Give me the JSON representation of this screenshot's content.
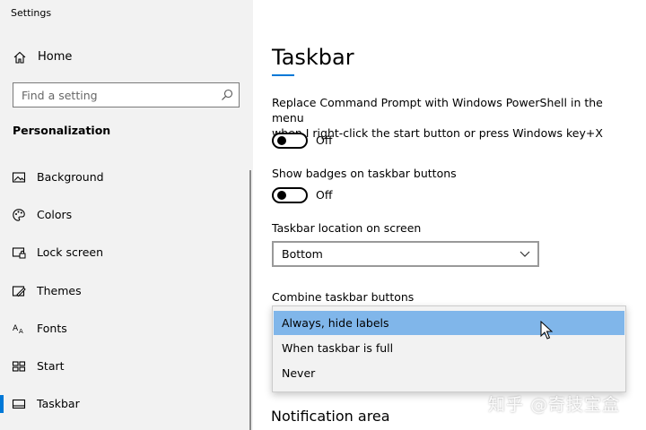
{
  "window": {
    "title": "Settings"
  },
  "sidebar": {
    "home_label": "Home",
    "search_placeholder": "Find a setting",
    "section_title": "Personalization",
    "items": [
      {
        "label": "Background",
        "icon": "image-icon"
      },
      {
        "label": "Colors",
        "icon": "palette-icon"
      },
      {
        "label": "Lock screen",
        "icon": "lock-screen-icon"
      },
      {
        "label": "Themes",
        "icon": "themes-icon"
      },
      {
        "label": "Fonts",
        "icon": "fonts-icon"
      },
      {
        "label": "Start",
        "icon": "start-icon"
      },
      {
        "label": "Taskbar",
        "icon": "taskbar-icon",
        "active": true
      }
    ]
  },
  "main": {
    "title": "Taskbar",
    "settings": {
      "powershell": {
        "line1": "Replace Command Prompt with Windows PowerShell in the menu",
        "line2": "when I right-click the start button or press Windows key+X",
        "state": "Off"
      },
      "badges": {
        "label": "Show badges on taskbar buttons",
        "state": "Off"
      },
      "location": {
        "label": "Taskbar location on screen",
        "value": "Bottom"
      },
      "combine": {
        "label": "Combine taskbar buttons",
        "options": [
          "Always, hide labels",
          "When taskbar is full",
          "Never"
        ],
        "selected": "Always, hide labels"
      }
    },
    "notification_heading": "Notification area"
  },
  "watermark": "知乎 @奇技宝盒",
  "colors": {
    "accent": "#0078d7",
    "selection": "#80b6ea",
    "sidebar_bg": "#f2f2f2"
  }
}
